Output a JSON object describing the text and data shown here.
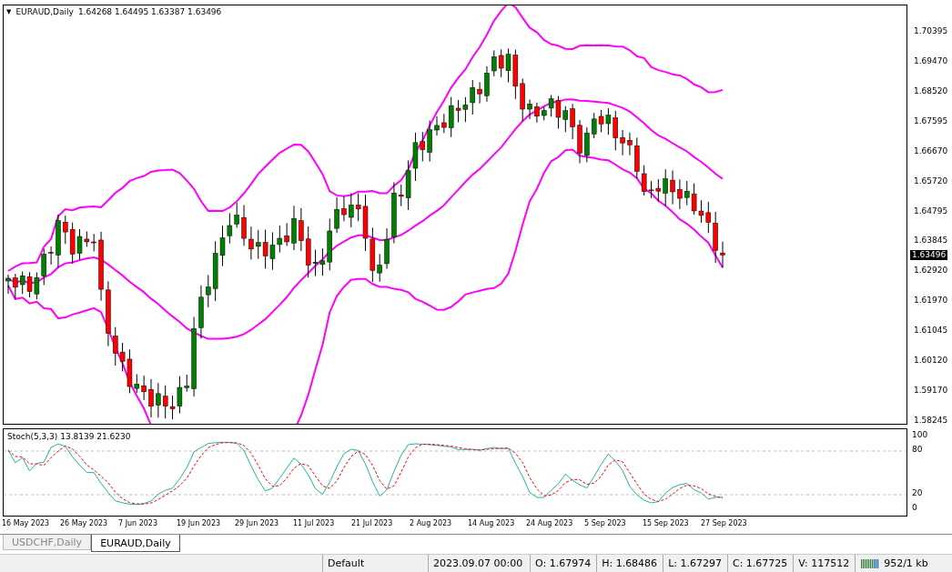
{
  "chart": {
    "symbol_menu": "▼",
    "title": "EURAUD,Daily",
    "ohlc": "1.64268 1.64495 1.63387 1.63496",
    "price_axis": [
      "1.70395",
      "1.69470",
      "1.68520",
      "1.67595",
      "1.66670",
      "1.65720",
      "1.64795",
      "1.63845",
      "1.62920",
      "1.61970",
      "1.61045",
      "1.60120",
      "1.59170",
      "1.58245"
    ],
    "current_price": "1.63496"
  },
  "stochastic": {
    "title": "Stoch(5,3,3) 13.8139 21.6230",
    "axis": [
      "100",
      "80",
      "20",
      "0"
    ]
  },
  "dates": [
    "16 May 2023",
    "26 May 2023",
    "7 Jun 2023",
    "19 Jun 2023",
    "29 Jun 2023",
    "11 Jul 2023",
    "21 Jul 2023",
    "2 Aug 2023",
    "14 Aug 2023",
    "24 Aug 2023",
    "5 Sep 2023",
    "15 Sep 2023",
    "27 Sep 2023"
  ],
  "tabs": [
    {
      "label": "USDCHF,Daily",
      "selected": false
    },
    {
      "label": "EURAUD,Daily",
      "selected": true
    }
  ],
  "status_bar": {
    "profile": "Default",
    "time": "2023.09.07 00:00",
    "open": "O: 1.67974",
    "high": "H: 1.68486",
    "low": "L: 1.67297",
    "close": "C: 1.67725",
    "volume": "V: 117512",
    "traffic": "952/1 kb"
  }
}
